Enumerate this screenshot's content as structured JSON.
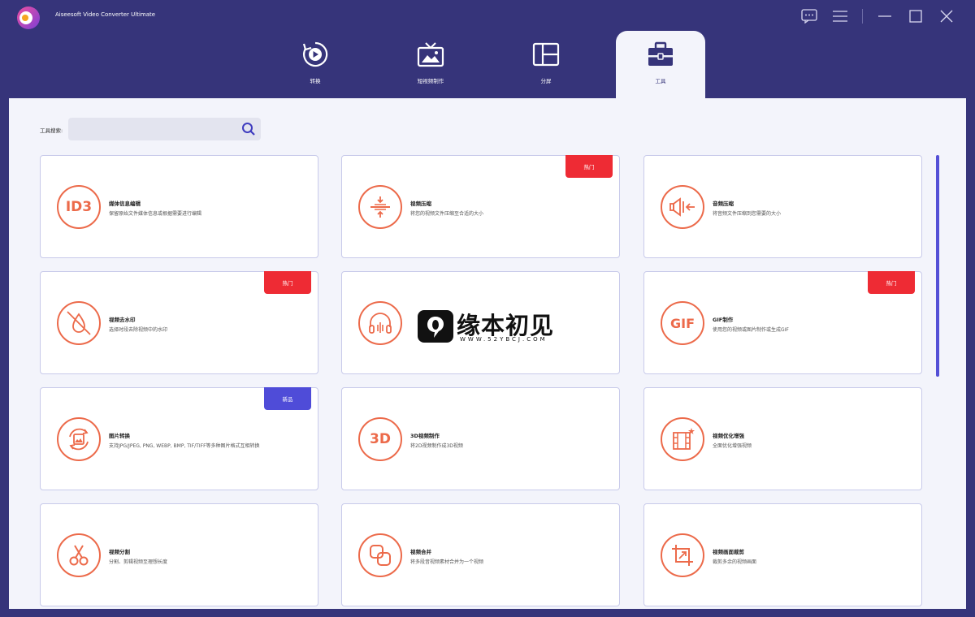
{
  "app": {
    "title": "Aiseesoft Video Converter Ultimate"
  },
  "colors": {
    "header_bg": "#36347a",
    "accent": "#ec6a4a",
    "hot": "#ee2b34",
    "new": "#4f4cd8",
    "content_bg": "#f3f4fb"
  },
  "window_controls": [
    "feedback-icon",
    "menu-icon",
    "minimize-icon",
    "maximize-icon",
    "close-icon"
  ],
  "tabs": [
    {
      "label": "转换",
      "icon": "convert-icon"
    },
    {
      "label": "短视频制作",
      "icon": "mv-icon"
    },
    {
      "label": "分屏",
      "icon": "collage-icon"
    },
    {
      "label": "工具",
      "icon": "toolbox-icon",
      "active": true
    }
  ],
  "search": {
    "label": "工具搜索:",
    "value": "",
    "placeholder": ""
  },
  "tools": [
    {
      "title": "媒体信息编辑",
      "desc": "保留原始文件媒体信息或根据需要进行编辑",
      "icon_text": "ID3",
      "badge": ""
    },
    {
      "title": "视频压缩",
      "desc": "将您的视频文件压缩至合适的大小",
      "icon_text": "",
      "icon": "compress-icon",
      "badge": "热门"
    },
    {
      "title": "音频压缩",
      "desc": "将音频文件压缩到您需要的大小",
      "icon_text": "",
      "icon": "audio-compress-icon",
      "badge": ""
    },
    {
      "title": "视频去水印",
      "desc": "选择时段去除视频中的水印",
      "icon_text": "",
      "icon": "watermark-remove-icon",
      "badge": "热门"
    },
    {
      "title": "",
      "desc": "",
      "icon_text": "",
      "icon": "headphone-icon",
      "badge": ""
    },
    {
      "title": "GIF制作",
      "desc": "使用您的视频或图片制作或生成GIF",
      "icon_text": "GIF",
      "badge": "热门"
    },
    {
      "title": "图片转换",
      "desc": "支持JPG/JPEG, PNG, WEBP, BMP, TIF/TIFF等多种图片格式互相转换",
      "icon_text": "",
      "icon": "image-convert-icon",
      "badge": "新品"
    },
    {
      "title": "3D视频制作",
      "desc": "将2D视频制作成3D视频",
      "icon_text": "3D",
      "badge": ""
    },
    {
      "title": "视频优化增强",
      "desc": "全面优化增强视频",
      "icon_text": "",
      "icon": "enhance-icon",
      "badge": ""
    },
    {
      "title": "视频分割",
      "desc": "分割、剪辑视频至理想长度",
      "icon_text": "",
      "icon": "scissors-icon",
      "badge": ""
    },
    {
      "title": "视频合并",
      "desc": "将多段音视频素材合并为一个视频",
      "icon_text": "",
      "icon": "merge-icon",
      "badge": ""
    },
    {
      "title": "视频画面裁剪",
      "desc": "裁剪多余的视频画面",
      "icon_text": "",
      "icon": "crop-icon",
      "badge": ""
    }
  ],
  "watermark": {
    "text": "缘本初见",
    "url": "WWW.52YBCJ.COM"
  }
}
